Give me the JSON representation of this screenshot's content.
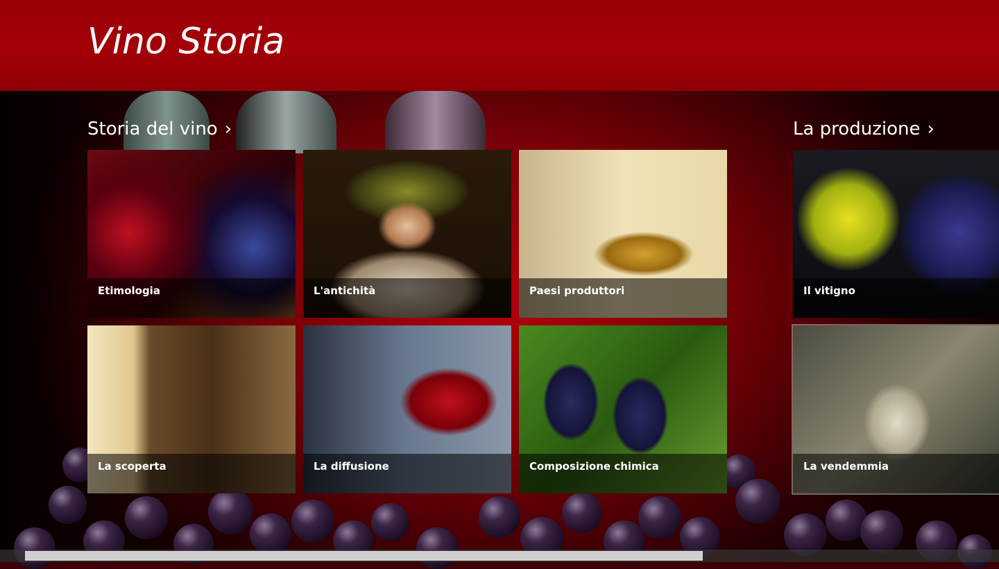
{
  "app": {
    "title": "Vino Storia"
  },
  "groups": [
    {
      "title": "Storia del vino",
      "tiles": [
        {
          "label": "Etimologia"
        },
        {
          "label": "L'antichità"
        },
        {
          "label": "Paesi produttori"
        },
        {
          "label": "La scoperta"
        },
        {
          "label": "La diffusione"
        },
        {
          "label": "Composizione chimica"
        }
      ]
    },
    {
      "title": "La produzione",
      "tiles": [
        {
          "label": "Il vitigno"
        },
        {
          "label": "La vendemmia"
        }
      ]
    }
  ],
  "scrollbar": {
    "left_arrow": "‹",
    "right_arrow": "›"
  },
  "icons": {
    "group_chevron": "chevron-right-icon"
  },
  "colors": {
    "header": "#a40008",
    "background": "#7a0008",
    "caption_overlay": "rgba(0,0,0,0.55)"
  }
}
